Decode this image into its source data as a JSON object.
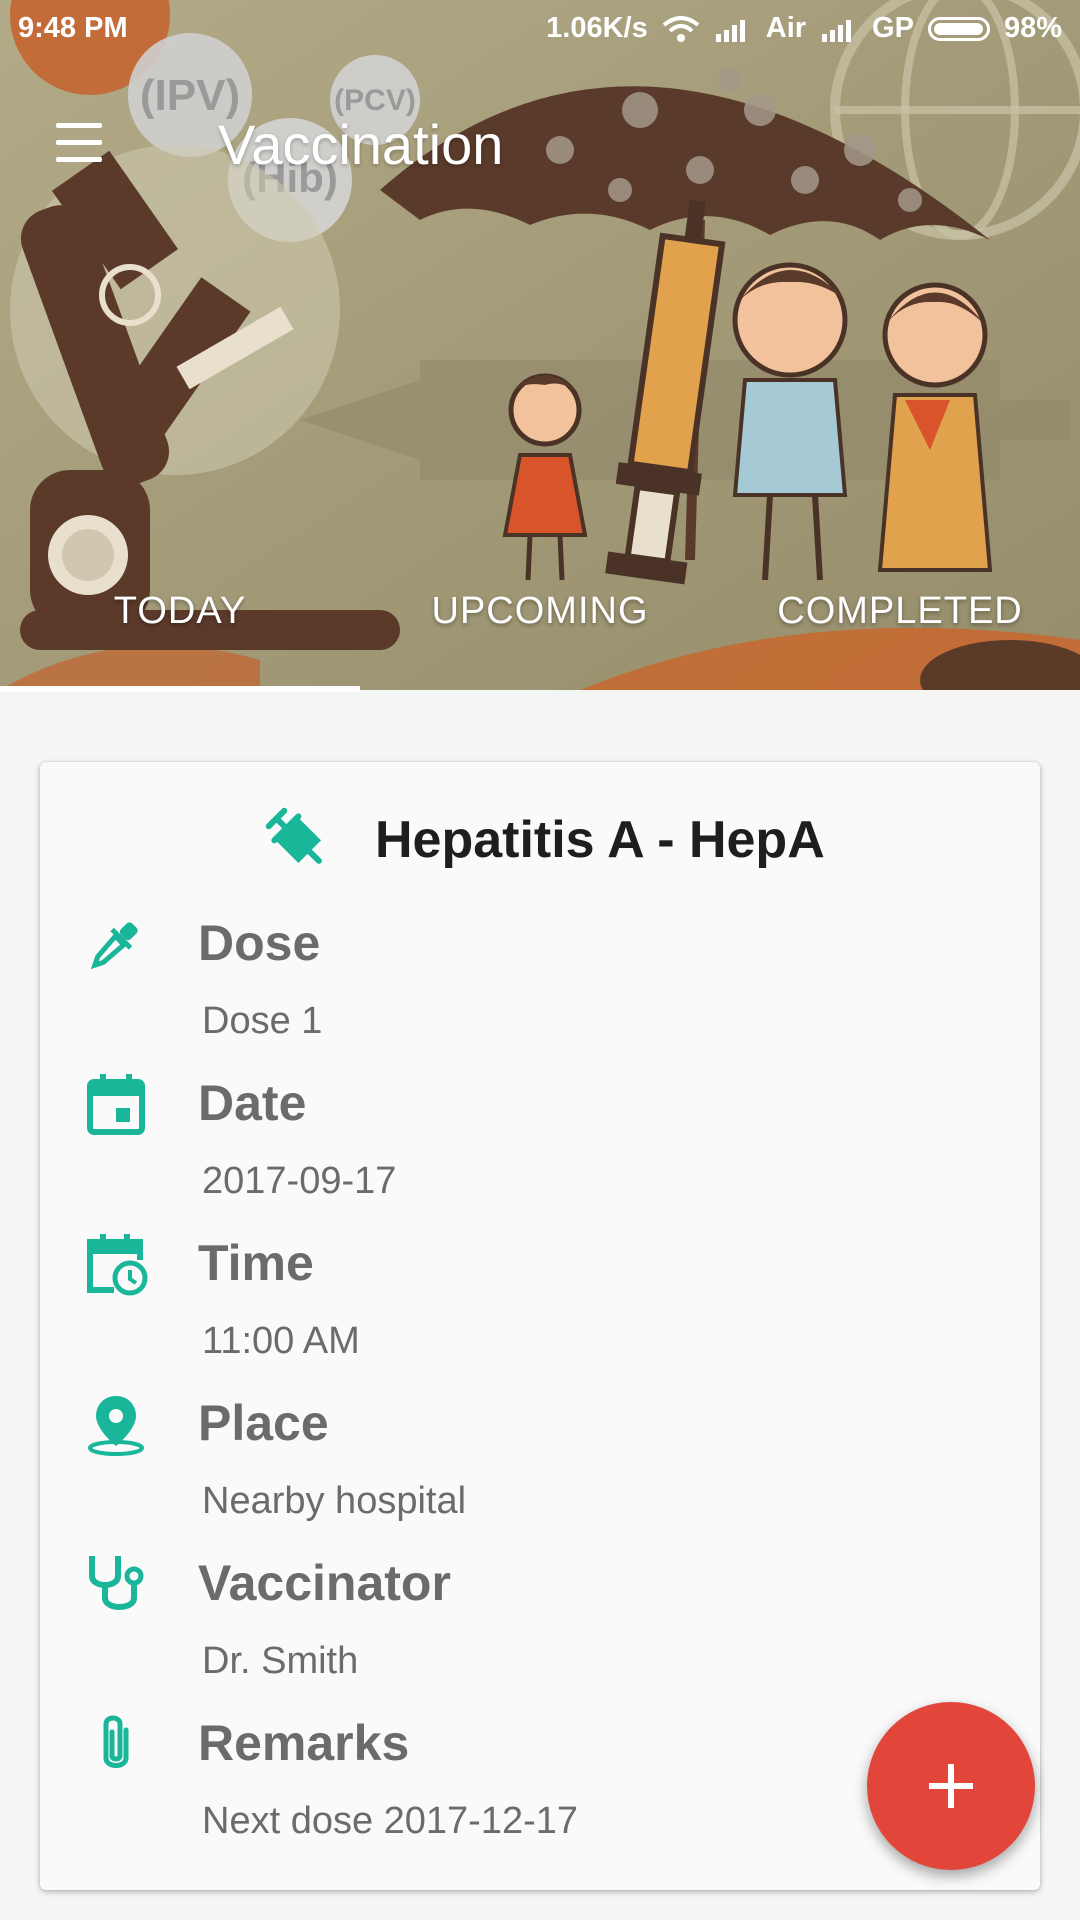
{
  "status_bar": {
    "time": "9:48 PM",
    "network_speed": "1.06K/s",
    "carrier_1": "Air",
    "carrier_2": "GP",
    "battery": "98%"
  },
  "toolbar": {
    "menu_icon": "hamburger-menu-icon",
    "title": "Vaccination"
  },
  "hero_badges": [
    "(IPV)",
    "(PCV)",
    "(Hib)"
  ],
  "tabs": [
    {
      "label": "TODAY",
      "selected": true
    },
    {
      "label": "UPCOMING",
      "selected": false
    },
    {
      "label": "COMPLETED",
      "selected": false
    }
  ],
  "card": {
    "title_icon": "syringe-icon",
    "title": "Hepatitis A - HepA",
    "rows": [
      {
        "icon": "dropper-icon",
        "label": "Dose",
        "value": "Dose 1"
      },
      {
        "icon": "calendar-icon",
        "label": "Date",
        "value": "2017-09-17"
      },
      {
        "icon": "calendar-clock-icon",
        "label": "Time",
        "value": "11:00 AM"
      },
      {
        "icon": "location-pin-icon",
        "label": "Place",
        "value": "Nearby hospital"
      },
      {
        "icon": "stethoscope-icon",
        "label": "Vaccinator",
        "value": "Dr. Smith"
      },
      {
        "icon": "paperclip-icon",
        "label": "Remarks",
        "value": "Next dose 2017-12-17"
      }
    ]
  },
  "fab": {
    "icon": "plus-icon"
  },
  "colors": {
    "accent": "#1ab69a",
    "fab": "#e2463a",
    "label": "#6b6b6b",
    "title": "#1e1e1e",
    "hero_bg": "#a49c7b"
  }
}
